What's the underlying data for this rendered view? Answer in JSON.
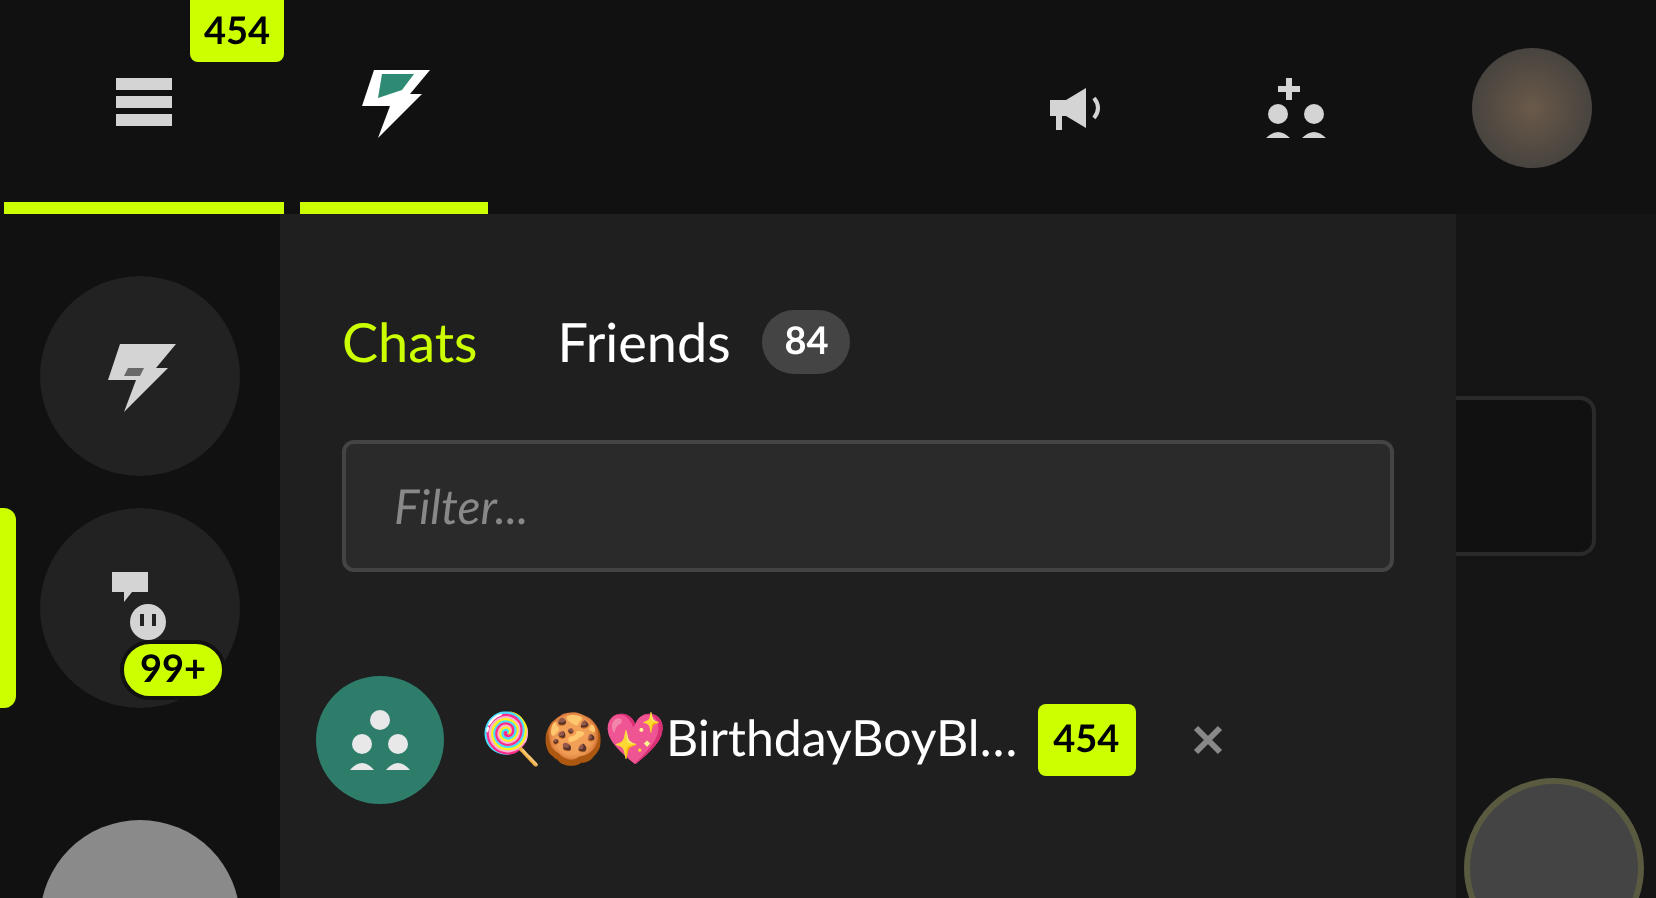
{
  "top_nav": {
    "items": [
      {
        "kind": "menu",
        "selected": true,
        "badge": "454"
      },
      {
        "kind": "home",
        "selected": true
      }
    ]
  },
  "rail": {
    "items": [
      {
        "kind": "home",
        "selected": false
      },
      {
        "kind": "messages",
        "selected": true,
        "badge": "99+"
      }
    ]
  },
  "panel": {
    "tabs": [
      {
        "label": "Chats",
        "selected": true
      },
      {
        "label": "Friends",
        "selected": false,
        "count": "84"
      }
    ],
    "filter": {
      "placeholder": "Filter..."
    },
    "chats": [
      {
        "name": "🍭🍪💖BirthdayBoyBl…",
        "unread": "454"
      }
    ]
  }
}
